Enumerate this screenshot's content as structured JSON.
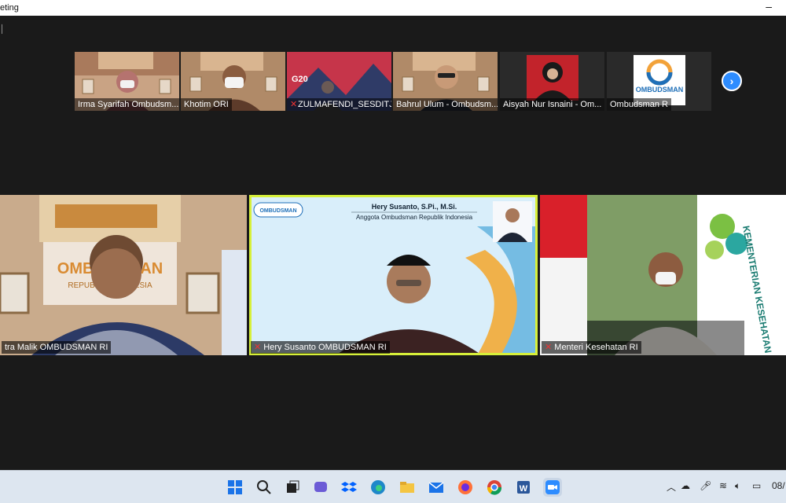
{
  "window": {
    "title": "eting",
    "minimize_glyph": "–"
  },
  "corner_glyph": "│",
  "thumbnails": [
    {
      "name": "Irma Syarifah Ombudsm...",
      "muted": false
    },
    {
      "name": "Khotim ORI",
      "muted": false
    },
    {
      "name": "ZULMAFENDI_SESDITJ...",
      "muted": true
    },
    {
      "name": "Bahrul Ulum - Ombudsm...",
      "muted": false
    },
    {
      "name": "Aisyah Nur Isnaini - Om...",
      "muted": false
    },
    {
      "name": "Ombudsman R",
      "muted": false
    }
  ],
  "thumb_texts": {
    "g20": "G20",
    "ombudsman_logo": "OMBUDSMAN"
  },
  "next_button": "›",
  "tiles": [
    {
      "label": "tra Malik OMBUDSMAN RI",
      "muted": false,
      "banner_line1": "OMBUDSMAN",
      "banner_line2": "REPUBLIK INDONESIA"
    },
    {
      "label": "Hery Susanto OMBUDSMAN RI",
      "muted": true,
      "speaker_name": "Hery Susanto, S.Pi., M.Si.",
      "speaker_title": "Anggota Ombudsman Republik Indonesia",
      "badge": "OMBUDSMAN"
    },
    {
      "label": "Menteri Kesehatan RI",
      "muted": true,
      "banner": "KEMENTERIAN KESEHATAN REPUBLIK INDONESIA"
    }
  ],
  "taskbar": {
    "clock": "08/"
  },
  "colors": {
    "accent": "#2d8cff",
    "active_border": "#d7f03a",
    "muted": "#e33333"
  }
}
